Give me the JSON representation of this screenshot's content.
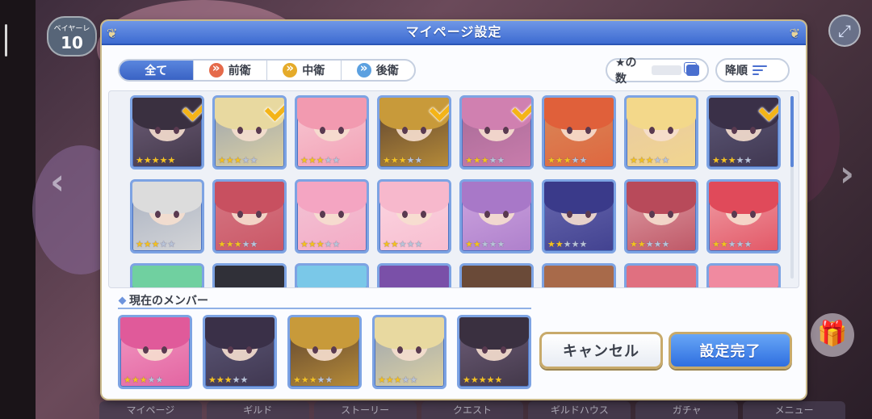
{
  "background": {
    "level_label": "ベイヤーレ",
    "level_value": "10",
    "bottom_tabs": [
      "マイページ",
      "ギルド",
      "ストーリー",
      "クエスト",
      "ギルドハウス",
      "ガチャ",
      "メニュー"
    ]
  },
  "dialog": {
    "title": "マイページ設定",
    "tabs": [
      {
        "label": "全て",
        "icon": "none",
        "active": true
      },
      {
        "label": "前衛",
        "icon": "front-position-icon",
        "active": false
      },
      {
        "label": "中衛",
        "icon": "middle-position-icon",
        "active": false
      },
      {
        "label": "後衛",
        "icon": "back-position-icon",
        "active": false
      }
    ],
    "star_sort_label": "★の数",
    "order_label": "降順",
    "characters": [
      {
        "stars": 5,
        "max": 5,
        "selected": true,
        "hair": "#3a3040",
        "bg": "#6f5f7a"
      },
      {
        "stars": 3,
        "max": 5,
        "selected": true,
        "hair": "#e8d9a0",
        "bg": "#9aa3b0"
      },
      {
        "stars": 3,
        "max": 5,
        "selected": false,
        "hair": "#f29ab0",
        "bg": "#f7c9d4"
      },
      {
        "stars": 3,
        "max": 5,
        "selected": true,
        "hair": "#c89a3a",
        "bg": "#5a4030"
      },
      {
        "stars": 3,
        "max": 5,
        "selected": true,
        "hair": "#d080b0",
        "bg": "#a56a96"
      },
      {
        "stars": 3,
        "max": 5,
        "selected": false,
        "hair": "#e0603a",
        "bg": "#d88a5a"
      },
      {
        "stars": 3,
        "max": 5,
        "selected": false,
        "hair": "#f3d88a",
        "bg": "#e8c9a5"
      },
      {
        "stars": 3,
        "max": 5,
        "selected": true,
        "hair": "#3a3048",
        "bg": "#5e5a7a"
      },
      {
        "stars": 3,
        "max": 5,
        "selected": false,
        "hair": "#dcdcdc",
        "bg": "#a8b0c0"
      },
      {
        "stars": 3,
        "max": 5,
        "selected": false,
        "hair": "#c85060",
        "bg": "#d67a86"
      },
      {
        "stars": 3,
        "max": 5,
        "selected": false,
        "hair": "#f4a5c2",
        "bg": "#f2c6d6"
      },
      {
        "stars": 2,
        "max": 5,
        "selected": false,
        "hair": "#f7b8cc",
        "bg": "#fbd7e2"
      },
      {
        "stars": 2,
        "max": 5,
        "selected": false,
        "hair": "#a878c8",
        "bg": "#cfa7e0"
      },
      {
        "stars": 2,
        "max": 5,
        "selected": false,
        "hair": "#3a3a8a",
        "bg": "#6a6ab0"
      },
      {
        "stars": 2,
        "max": 5,
        "selected": false,
        "hair": "#b84a5a",
        "bg": "#e0a0a8"
      },
      {
        "stars": 2,
        "max": 5,
        "selected": false,
        "hair": "#e04a5a",
        "bg": "#f0a0a8"
      },
      {
        "stars": 0,
        "max": 5,
        "selected": false,
        "hair": "#70d0a0",
        "bg": "#c0ecd8"
      },
      {
        "stars": 0,
        "max": 5,
        "selected": false,
        "hair": "#303038",
        "bg": "#6a6a78"
      },
      {
        "stars": 0,
        "max": 5,
        "selected": false,
        "hair": "#7ac8e8",
        "bg": "#c8e8f4"
      },
      {
        "stars": 0,
        "max": 5,
        "selected": false,
        "hair": "#7a50a8",
        "bg": "#a890c8"
      },
      {
        "stars": 0,
        "max": 5,
        "selected": false,
        "hair": "#6a4a38",
        "bg": "#a88a74"
      },
      {
        "stars": 0,
        "max": 5,
        "selected": false,
        "hair": "#a86a4a",
        "bg": "#d8a888"
      },
      {
        "stars": 0,
        "max": 5,
        "selected": false,
        "hair": "#e07080",
        "bg": "#f0b0b8"
      },
      {
        "stars": 0,
        "max": 5,
        "selected": false,
        "hair": "#f08aa0",
        "bg": "#f8c8d4"
      }
    ],
    "members_title": "現在のメンバー",
    "members": [
      {
        "stars": 3,
        "max": 5,
        "hair": "#e05a9a",
        "bg": "#f29ac4"
      },
      {
        "stars": 3,
        "max": 5,
        "hair": "#3a3048",
        "bg": "#5e5a7a"
      },
      {
        "stars": 3,
        "max": 5,
        "hair": "#c89a3a",
        "bg": "#5a4030"
      },
      {
        "stars": 3,
        "max": 5,
        "hair": "#e8d9a0",
        "bg": "#9aa3b0"
      },
      {
        "stars": 5,
        "max": 5,
        "hair": "#3a3040",
        "bg": "#6f5f7a"
      }
    ],
    "cancel_label": "キャンセル",
    "confirm_label": "設定完了"
  }
}
